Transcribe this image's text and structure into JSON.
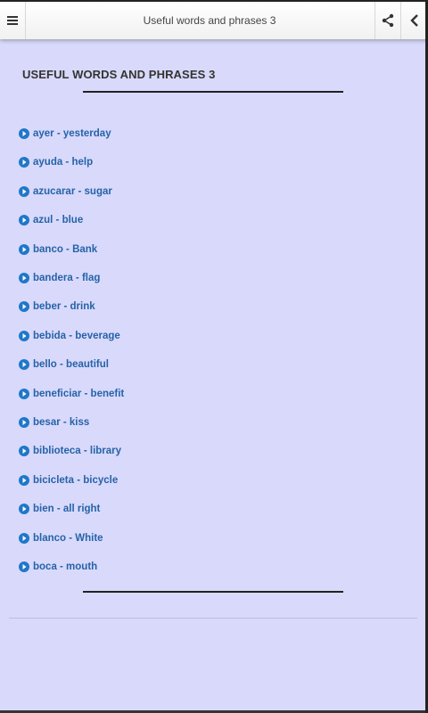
{
  "toolbar": {
    "title": "Useful words and phrases 3",
    "menu_icon": "hamburger-menu-icon",
    "share_icon": "share-icon",
    "back_icon": "chevron-left-icon"
  },
  "content": {
    "heading": "USEFUL WORDS AND PHRASES 3",
    "items": [
      "ayer - yesterday",
      "ayuda - help",
      "azucarar - sugar",
      "azul - blue",
      "banco - Bank",
      "bandera - flag",
      "beber - drink",
      "bebida - beverage",
      "bello - beautiful",
      "beneficiar - benefit",
      "besar - kiss",
      "biblioteca - library",
      "bicicleta - bicycle",
      "bien - all right",
      "blanco - White",
      "boca - mouth"
    ]
  },
  "colors": {
    "background": "#d9d9fb",
    "link": "#2563a8",
    "bullet": "#1f77c9"
  }
}
